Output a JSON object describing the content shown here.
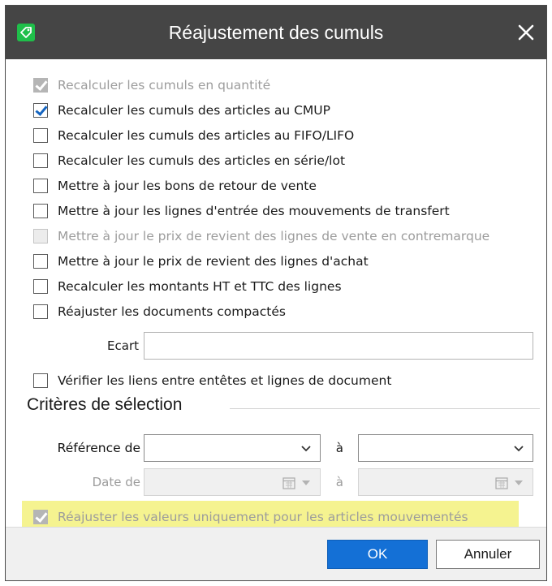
{
  "dialog": {
    "title": "Réajustement des cumuls",
    "icon": "tag-icon",
    "accent_color": "#1470d6",
    "titlebar_color": "#454545"
  },
  "options": [
    {
      "label": "Recalculer les cumuls en quantité",
      "checked": true,
      "disabled": true
    },
    {
      "label": "Recalculer les cumuls des articles au CMUP",
      "checked": true,
      "disabled": false
    },
    {
      "label": "Recalculer les cumuls des articles au FIFO/LIFO",
      "checked": false,
      "disabled": false
    },
    {
      "label": "Recalculer les cumuls des articles en série/lot",
      "checked": false,
      "disabled": false
    },
    {
      "label": "Mettre à jour les bons de retour de vente",
      "checked": false,
      "disabled": false
    },
    {
      "label": "Mettre à jour les lignes d'entrée des mouvements de transfert",
      "checked": false,
      "disabled": false
    },
    {
      "label": "Mettre à jour le prix de revient des lignes de vente en contremarque",
      "checked": false,
      "disabled": true
    },
    {
      "label": "Mettre à jour le prix de revient des lignes d'achat",
      "checked": false,
      "disabled": false
    },
    {
      "label": "Recalculer les montants HT et TTC des lignes",
      "checked": false,
      "disabled": false
    },
    {
      "label": "Réajuster les documents compactés",
      "checked": false,
      "disabled": false
    }
  ],
  "ecart": {
    "label": "Ecart",
    "value": ""
  },
  "verify_links": {
    "label": "Vérifier les liens entre entêtes et lignes de document",
    "checked": false
  },
  "criteria": {
    "title": "Critères de sélection",
    "reference_from_label": "Référence de",
    "reference_from_value": "",
    "reference_to_label": "à",
    "reference_to_value": "",
    "date_from_label": "Date de",
    "date_from_value": "",
    "date_to_label": "à",
    "date_to_value": ""
  },
  "only_moved": {
    "label": "Réajuster les valeurs uniquement pour les articles mouvementés",
    "checked": true,
    "disabled": true,
    "highlight_color": "#f5f390"
  },
  "buttons": {
    "ok": "OK",
    "cancel": "Annuler"
  }
}
